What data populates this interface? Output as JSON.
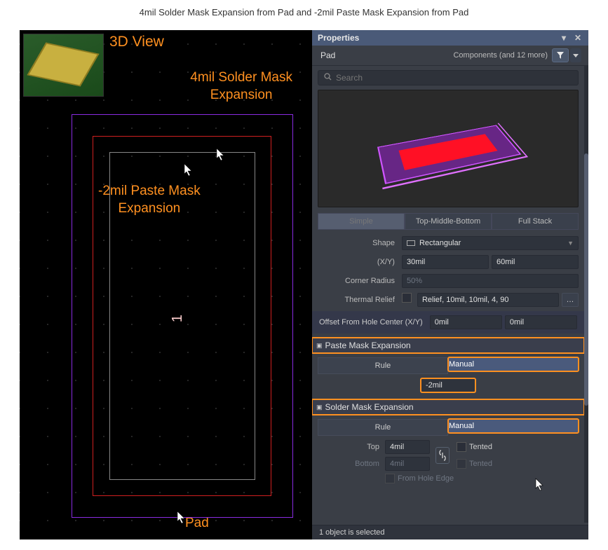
{
  "page_title": "4mil Solder Mask Expansion from Pad and -2mil Paste Mask Expansion from Pad",
  "left": {
    "view_label": "3D View",
    "solder_label": "4mil Solder Mask\nExpansion",
    "paste_label": "-2mil Paste Mask\nExpansion",
    "pad_label": "Pad",
    "designator": "1"
  },
  "panel": {
    "title": "Properties",
    "object": "Pad",
    "scope": "Components (and 12 more)",
    "search_placeholder": "Search",
    "mode_tabs": {
      "simple": "Simple",
      "tmb": "Top-Middle-Bottom",
      "full": "Full Stack"
    },
    "shape": {
      "label": "Shape",
      "value": "Rectangular"
    },
    "xy": {
      "label": "(X/Y)",
      "x": "30mil",
      "y": "60mil"
    },
    "corner": {
      "label": "Corner Radius",
      "value": "50%"
    },
    "thermal": {
      "label": "Thermal Relief",
      "check": false,
      "value": "Relief, 10mil, 10mil, 4, 90"
    },
    "offset": {
      "label": "Offset From Hole Center (X/Y)",
      "x": "0mil",
      "y": "0mil"
    },
    "paste": {
      "header": "Paste Mask Expansion",
      "rule": "Rule",
      "manual": "Manual",
      "value": "-2mil"
    },
    "solder": {
      "header": "Solder Mask Expansion",
      "rule": "Rule",
      "manual": "Manual",
      "top_label": "Top",
      "top": "4mil",
      "bottom_label": "Bottom",
      "bottom": "4mil",
      "tented": "Tented",
      "from_edge": "From Hole Edge"
    },
    "status": "1 object is selected"
  }
}
